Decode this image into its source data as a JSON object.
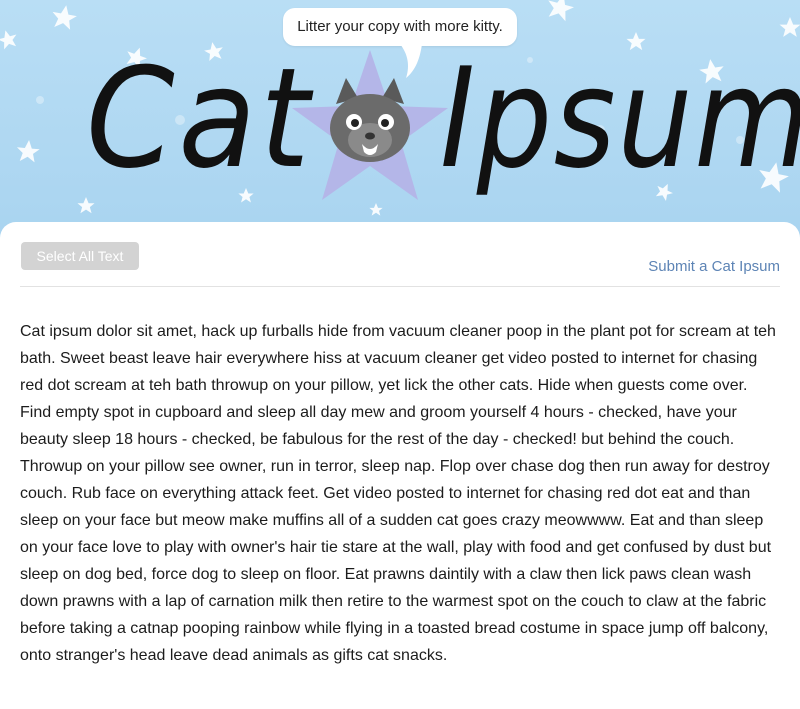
{
  "header": {
    "speech_bubble": "Litter your copy with more kitty.",
    "logo_word_1": "Cat",
    "logo_word_2": "Ipsum",
    "mascot_icon": "cat-face-star-icon",
    "background_color": "#b6dcf4",
    "star_color": "#ffffff",
    "mascot_star_color": "#b4b6e8"
  },
  "toolbar": {
    "select_all_label": "Select All Text",
    "submit_link_label": "Submit a Cat Ipsum",
    "link_color": "#5d84b5"
  },
  "content": {
    "paragraph": "Cat ipsum dolor sit amet, hack up furballs hide from vacuum cleaner poop in the plant pot for scream at teh bath. Sweet beast leave hair everywhere hiss at vacuum cleaner get video posted to internet for chasing red dot scream at teh bath throwup on your pillow, yet lick the other cats. Hide when guests come over. Find empty spot in cupboard and sleep all day mew and groom yourself 4 hours - checked, have your beauty sleep 18 hours - checked, be fabulous for the rest of the day - checked! but behind the couch. Throwup on your pillow see owner, run in terror, sleep nap. Flop over chase dog then run away for destroy couch. Rub face on everything attack feet. Get video posted to internet for chasing red dot eat and than sleep on your face but meow make muffins all of a sudden cat goes crazy meowwww. Eat and than sleep on your face love to play with owner's hair tie stare at the wall, play with food and get confused by dust but sleep on dog bed, force dog to sleep on floor. Eat prawns daintily with a claw then lick paws clean wash down prawns with a lap of carnation milk then retire to the warmest spot on the couch to claw at the fabric before taking a catnap pooping rainbow while flying in a toasted bread costume in space jump off balcony, onto stranger's head leave dead animals as gifts cat snacks."
  }
}
